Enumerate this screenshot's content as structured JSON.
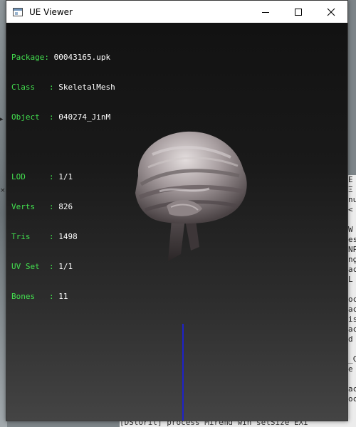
{
  "window": {
    "title": "UE Viewer",
    "controls": {
      "minimize": "minimize-icon",
      "maximize": "maximize-icon",
      "close": "close-icon"
    }
  },
  "info": {
    "package_label": "Package",
    "package_value": "00043165.upk",
    "class_label": "Class",
    "class_value": "SkeletalMesh",
    "object_label": "Object",
    "object_value": "040274_JinM",
    "lod_label": "LOD",
    "lod_value": "1/1",
    "verts_label": "Verts",
    "verts_value": "826",
    "tris_label": "Tris",
    "tris_value": "1498",
    "uvset_label": "UV Set",
    "uvset_value": "1/1",
    "bones_label": "Bones",
    "bones_value": "11"
  },
  "colors": {
    "label": "#43e04f",
    "value": "#ffffff",
    "axis": "#1e22c8"
  },
  "background": {
    "console_lines": [
      "E",
      "Ξ",
      "nu",
      "<",
      "",
      "W",
      "es",
      "NP",
      "ng",
      "ac",
      "L",
      "",
      "oc",
      "ac",
      "is",
      "ac",
      "d",
      "",
      "_C",
      "e",
      "",
      "ac",
      "oc"
    ],
    "bottom_strip": "[DStoril] process  Miremd win setSize  EXI"
  }
}
